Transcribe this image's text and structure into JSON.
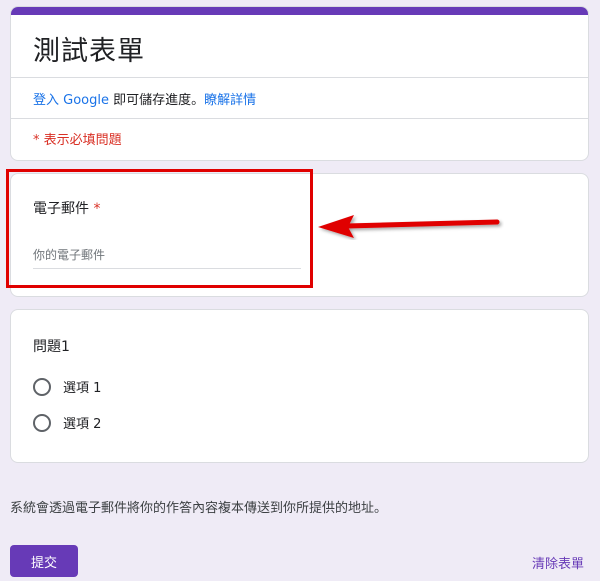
{
  "form": {
    "title": "測試表單",
    "signin": {
      "link_text": "登入 Google",
      "middle_text": " 即可儲存進度。",
      "learn_more": "瞭解詳情"
    },
    "required_note": "* 表示必填問題"
  },
  "email_question": {
    "label": "電子郵件",
    "required_mark": "*",
    "placeholder": "你的電子郵件",
    "value": ""
  },
  "question1": {
    "title": "問題1",
    "options": [
      "選項 1",
      "選項 2"
    ]
  },
  "footer": {
    "note": "系統會透過電子郵件將你的作答內容複本傳送到你所提供的地址。",
    "submit_label": "提交",
    "clear_label": "清除表單"
  },
  "colors": {
    "accent": "#673ab7",
    "background": "#efebf6",
    "required": "#d93025",
    "highlight": "#e00000",
    "link": "#1a73e8"
  },
  "annotation": {
    "highlight": "red-rectangle-around-email-question",
    "arrow": "red-arrow-pointing-left"
  }
}
